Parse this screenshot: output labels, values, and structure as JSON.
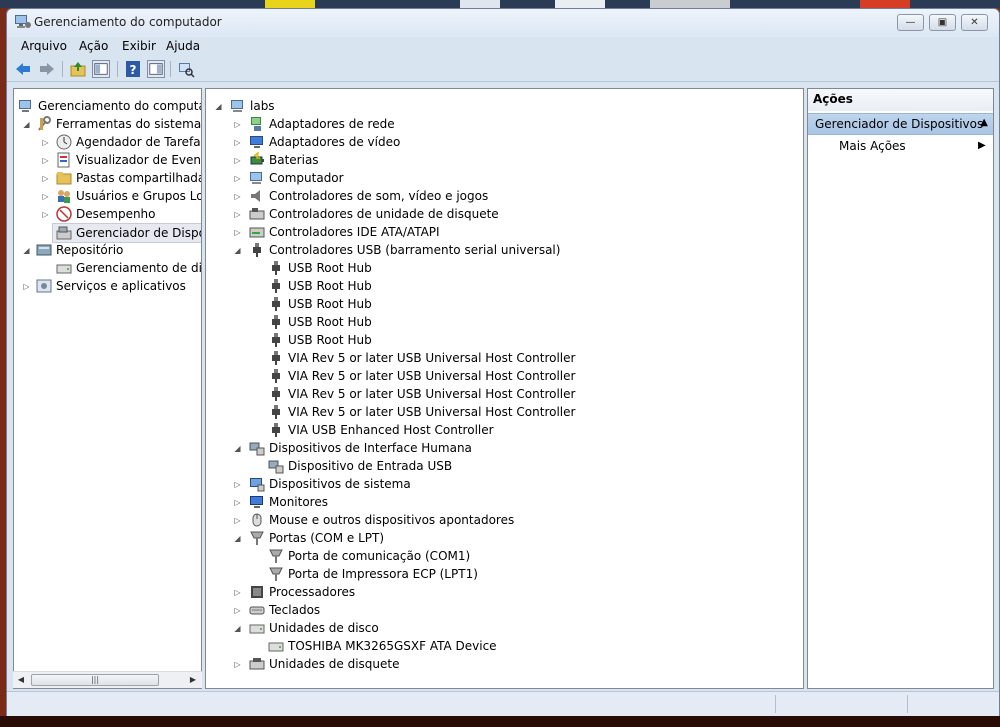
{
  "window": {
    "title": "Gerenciamento do computador",
    "controls": [
      "minimize",
      "maximize",
      "close"
    ]
  },
  "menu": [
    "Arquivo",
    "Ação",
    "Exibir",
    "Ajuda"
  ],
  "toolbar": [
    "back-arrow-icon",
    "forward-arrow-icon",
    "up-folder-icon",
    "show-hide-tree-icon",
    "help-icon",
    "properties-icon",
    "scan-hardware-icon"
  ],
  "left_tree": {
    "root": "Gerenciamento do computador",
    "items": [
      {
        "label": "Ferramentas do sistema"
      },
      {
        "label": "Agendador de Tarefas"
      },
      {
        "label": "Visualizador de Eventos"
      },
      {
        "label": "Pastas compartilhadas"
      },
      {
        "label": "Usuários e Grupos Locais"
      },
      {
        "label": "Desempenho"
      },
      {
        "label": "Gerenciador de Dispositivos"
      },
      {
        "label": "Repositório"
      },
      {
        "label": "Gerenciamento de disco"
      },
      {
        "label": "Serviços e aplicativos"
      }
    ]
  },
  "device_tree": {
    "root": "labs",
    "items": [
      "Adaptadores de rede",
      "Adaptadores de vídeo",
      "Baterias",
      "Computador",
      "Controladores de som, vídeo e jogos",
      "Controladores de unidade de disquete",
      "Controladores IDE ATA/ATAPI",
      "Controladores USB (barramento serial universal)",
      "USB Root Hub",
      "USB Root Hub",
      "USB Root Hub",
      "USB Root Hub",
      "USB Root Hub",
      "VIA Rev 5 or later USB Universal Host Controller",
      "VIA Rev 5 or later USB Universal Host Controller",
      "VIA Rev 5 or later USB Universal Host Controller",
      "VIA Rev 5 or later USB Universal Host Controller",
      "VIA USB Enhanced Host Controller",
      "Dispositivos de Interface Humana",
      "Dispositivo de Entrada USB",
      "Dispositivos de sistema",
      "Monitores",
      "Mouse e outros dispositivos apontadores",
      "Portas (COM e LPT)",
      "Porta de comunicação (COM1)",
      "Porta de Impressora ECP (LPT1)",
      "Processadores",
      "Teclados",
      "Unidades de disco",
      "TOSHIBA MK3265GSXF ATA Device",
      "Unidades de disquete"
    ]
  },
  "actions": {
    "header": "Ações",
    "section": "Gerenciador de Dispositivos",
    "item": "Mais Ações"
  }
}
